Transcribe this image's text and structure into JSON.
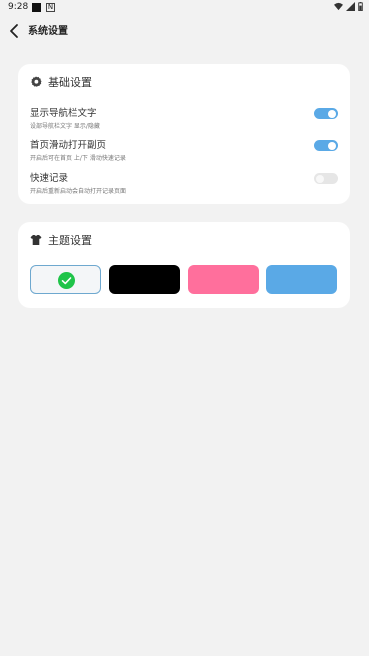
{
  "status_bar": {
    "time": "9:28",
    "notif_glyph": "N"
  },
  "header": {
    "title": "系统设置",
    "back_icon": "chevron-left-icon"
  },
  "basic_settings": {
    "title": "基础设置",
    "icon": "gear-icon",
    "items": [
      {
        "title": "显示导航栏文字",
        "desc": "设部导航栏文字 显示/隐藏",
        "enabled": true
      },
      {
        "title": "首页滑动打开副页",
        "desc": "开启后可在首页 上/下 滑动快速记录",
        "enabled": true
      },
      {
        "title": "快速记录",
        "desc": "开启后重新启动会自动打开记录页面",
        "enabled": false
      }
    ]
  },
  "theme_settings": {
    "title": "主题设置",
    "icon": "shirt-icon",
    "themes": [
      {
        "color": "#f4f6f8",
        "selected": true
      },
      {
        "color": "#000000",
        "selected": false
      },
      {
        "color": "#ff6f9c",
        "selected": false
      },
      {
        "color": "#5aa9e6",
        "selected": false
      }
    ]
  },
  "colors": {
    "accent": "#5aa9e6",
    "check": "#1fc449",
    "background": "#f2f2f2"
  }
}
